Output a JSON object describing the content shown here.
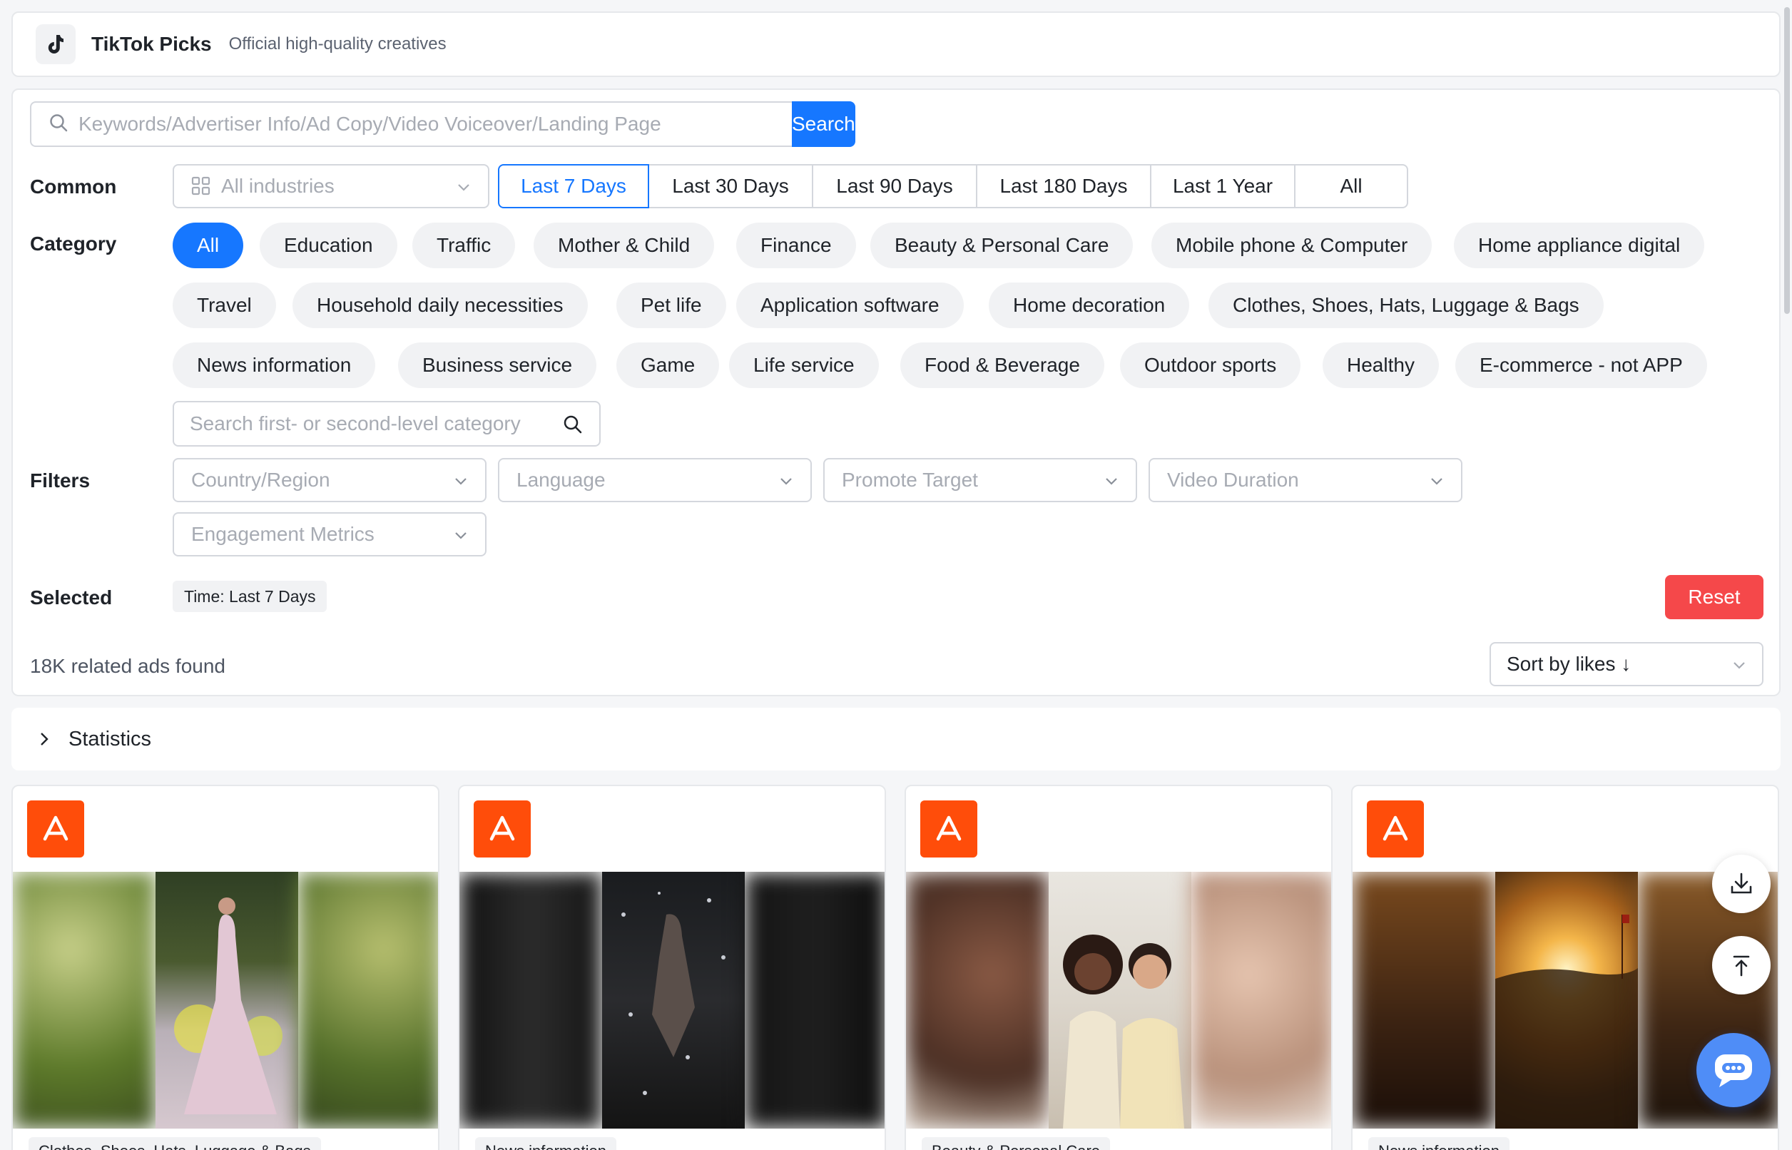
{
  "header": {
    "title": "TikTok Picks",
    "subtitle": "Official high-quality creatives",
    "icon": "tiktok-icon"
  },
  "search": {
    "placeholder": "Keywords/Advertiser Info/Ad Copy/Video Voiceover/Landing Page",
    "button_label": "Search",
    "icon": "search-icon"
  },
  "common": {
    "label": "Common",
    "industry_placeholder": "All industries",
    "time_ranges": [
      "Last 7 Days",
      "Last 30 Days",
      "Last 90 Days",
      "Last 180 Days",
      "Last 1 Year",
      "All"
    ],
    "active_time_range": "Last 7 Days"
  },
  "category": {
    "label": "Category",
    "items": [
      "All",
      "Education",
      "Traffic",
      "Mother & Child",
      "Finance",
      "Beauty & Personal Care",
      "Mobile phone & Computer",
      "Home appliance digital",
      "Travel",
      "Household daily necessities",
      "Pet life",
      "Application software",
      "Home decoration",
      "Clothes, Shoes, Hats, Luggage & Bags",
      "News information",
      "Business service",
      "Game",
      "Life service",
      "Food & Beverage",
      "Outdoor sports",
      "Healthy",
      "E-commerce - not APP"
    ],
    "active": "All",
    "search_placeholder": "Search first- or second-level category"
  },
  "filters": {
    "label": "Filters",
    "dropdowns": [
      "Country/Region",
      "Language",
      "Promote Target",
      "Video Duration",
      "Engagement Metrics"
    ]
  },
  "selected": {
    "label": "Selected",
    "tags": [
      "Time: Last 7 Days"
    ],
    "reset_label": "Reset"
  },
  "results": {
    "count_text": "18K related ads found",
    "sort_label": "Sort by likes ↓"
  },
  "statistics": {
    "label": "Statistics"
  },
  "cards": [
    {
      "category": "Clothes, Shoes, Hats, Luggage & Bags",
      "icon": "app-store-icon"
    },
    {
      "category": "News information",
      "icon": "app-store-icon"
    },
    {
      "category": "Beauty & Personal Care",
      "icon": "app-store-icon"
    },
    {
      "category": "News information",
      "icon": "app-store-icon"
    }
  ],
  "floating": {
    "download_icon": "download-icon",
    "top_icon": "back-to-top-icon",
    "chat_icon": "chat-icon"
  },
  "colors": {
    "primary": "#1677ff",
    "danger": "#f5484a",
    "app_badge": "#ff4d0a"
  }
}
